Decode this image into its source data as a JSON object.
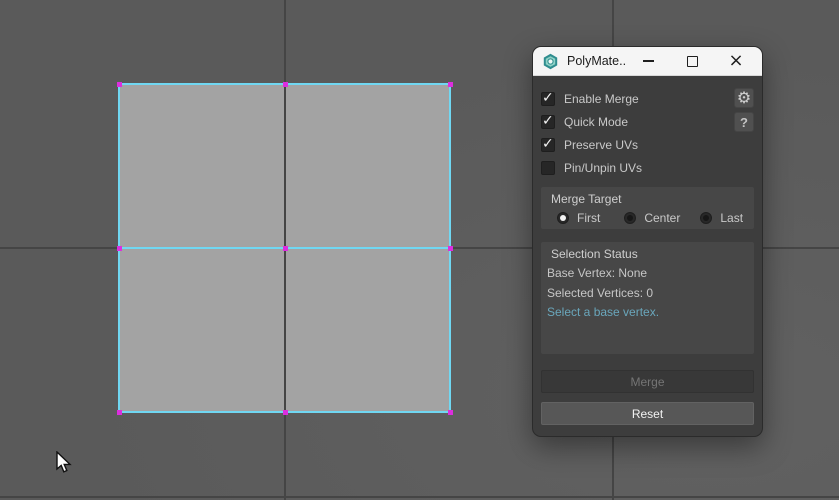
{
  "colors": {
    "viewport_bg": "#5a5a5a",
    "grid_line": "#454545",
    "face": "#a3a3a3",
    "edge": "#70d7f2",
    "vertex": "#dc2ede",
    "titlebar_bg": "#f5f5f5",
    "dialog_bg": "#3d3d3d",
    "panel_bg": "#474747",
    "hint_text": "#6aa7bc"
  },
  "viewport": {
    "mesh": "plane 2x2 faces selected, cyan edges, magenta vertices",
    "cursor": "arrow-cursor"
  },
  "window": {
    "title": "PolyMate...",
    "icon": "polymate-hexagon-icon",
    "controls": {
      "minimize": "minimize-icon",
      "maximize": "maximize-icon",
      "close": "close-icon"
    }
  },
  "options": {
    "checkboxes": [
      {
        "label": "Enable Merge",
        "checked": true
      },
      {
        "label": "Quick Mode",
        "checked": true
      },
      {
        "label": "Preserve UVs",
        "checked": true
      },
      {
        "label": "Pin/Unpin UVs",
        "checked": false
      }
    ]
  },
  "tools": {
    "settings_icon": "gear-icon",
    "help_label": "?"
  },
  "merge_target": {
    "label": "Merge Target",
    "options": [
      {
        "label": "First",
        "selected": true
      },
      {
        "label": "Center",
        "selected": false
      },
      {
        "label": "Last",
        "selected": false
      }
    ]
  },
  "selection_status": {
    "label": "Selection Status",
    "base_vertex": "Base Vertex: None",
    "selected_vertices": "Selected Vertices: 0",
    "hint": "Select a base vertex."
  },
  "actions": {
    "merge_label": "Merge",
    "reset_label": "Reset"
  }
}
